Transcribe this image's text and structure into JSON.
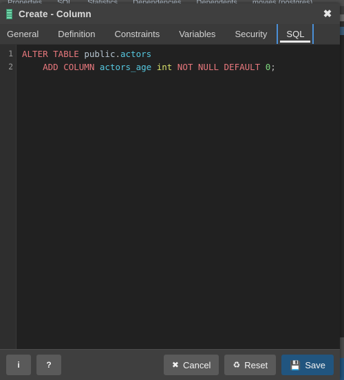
{
  "background": {
    "tabs": [
      {
        "label": "Properties"
      },
      {
        "label": "SQL"
      },
      {
        "label": "Statistics"
      },
      {
        "label": "Dependencies"
      },
      {
        "label": "Dependents"
      },
      {
        "label": "movies (postgres)"
      }
    ]
  },
  "dialog": {
    "title": "Create - Column",
    "icon": "column-icon",
    "close_label": "✖",
    "tabs": [
      {
        "label": "General",
        "active": false
      },
      {
        "label": "Definition",
        "active": false
      },
      {
        "label": "Constraints",
        "active": false
      },
      {
        "label": "Variables",
        "active": false
      },
      {
        "label": "Security",
        "active": false
      },
      {
        "label": "SQL",
        "active": true
      }
    ],
    "editor": {
      "line_numbers": [
        "1",
        "2"
      ],
      "lines": [
        {
          "number": "1",
          "tokens": [
            {
              "text": "ALTER TABLE ",
              "type": "keyword"
            },
            {
              "text": "public",
              "type": "schema"
            },
            {
              "text": ".",
              "type": "punct"
            },
            {
              "text": "actors",
              "type": "identifier"
            }
          ]
        },
        {
          "number": "2",
          "tokens": [
            {
              "text": "    ADD COLUMN ",
              "type": "keyword"
            },
            {
              "text": "actors_age ",
              "type": "identifier"
            },
            {
              "text": "int ",
              "type": "type"
            },
            {
              "text": "NOT NULL DEFAULT ",
              "type": "keyword"
            },
            {
              "text": "0",
              "type": "number"
            },
            {
              "text": ";",
              "type": "punct"
            }
          ]
        }
      ],
      "plain_text": "ALTER TABLE public.actors\n    ADD COLUMN actors_age int NOT NULL DEFAULT 0;"
    },
    "footer": {
      "info_label": "i",
      "help_label": "?",
      "cancel_icon": "✖",
      "cancel_label": "Cancel",
      "reset_icon": "♻",
      "reset_label": "Reset",
      "save_icon": "💾",
      "save_label": "Save"
    }
  },
  "colors": {
    "accent_blue": "#4a90d9",
    "save_blue": "#21557f",
    "dialog_bg": "#3b3b3b",
    "editor_bg": "#212121",
    "gutter_bg": "#2e2e2e",
    "keyword": "#e8787d",
    "identifier": "#56c8e0",
    "type": "#d8e06a",
    "number": "#7fd97f"
  }
}
